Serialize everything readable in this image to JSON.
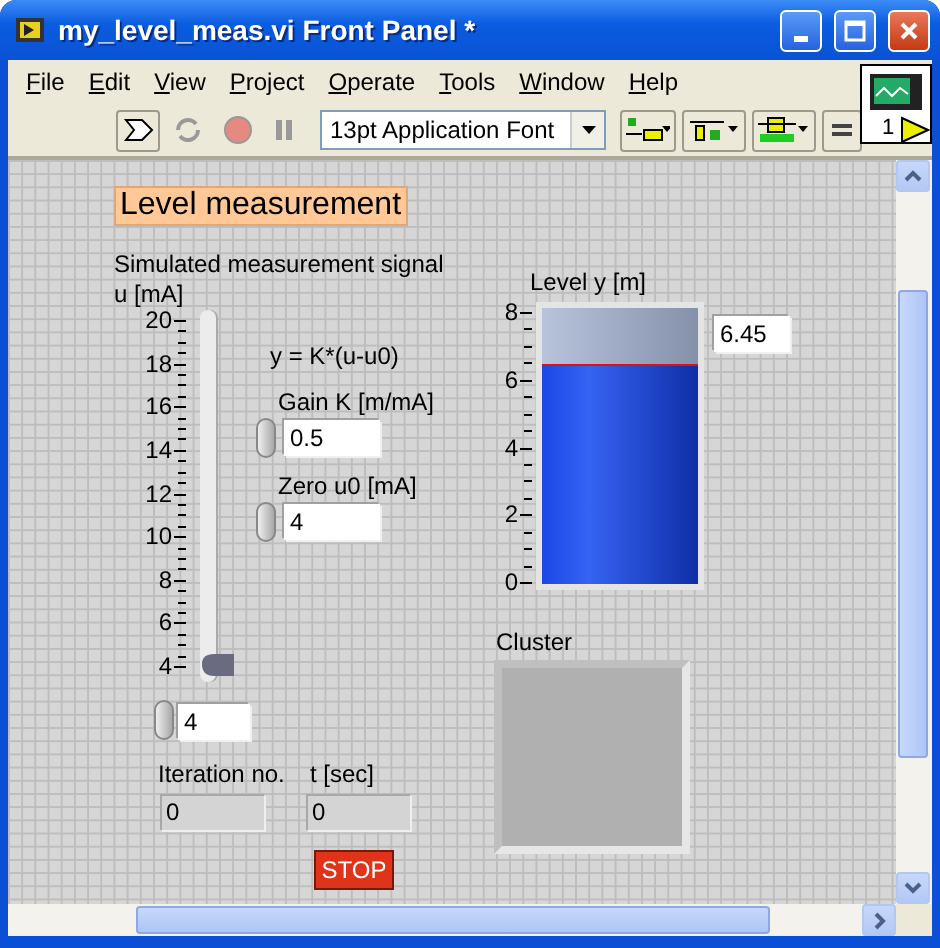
{
  "window": {
    "title": "my_level_meas.vi Front Panel *"
  },
  "menu": [
    "File",
    "Edit",
    "View",
    "Project",
    "Operate",
    "Tools",
    "Window",
    "Help"
  ],
  "toolbar": {
    "font": "13pt Application Font"
  },
  "connector_pane": {
    "text": "1"
  },
  "panel": {
    "heading": "Level measurement",
    "slider": {
      "label": "Simulated measurement signal\nu [mA]",
      "scale": [
        "20",
        "18",
        "16",
        "14",
        "12",
        "10",
        "8",
        "6",
        "4"
      ],
      "level": 0,
      "value": "4"
    },
    "formula": "y = K*(u-u0)",
    "gain": {
      "label": "Gain K [m/mA]",
      "value": "0.5"
    },
    "zero": {
      "label": "Zero u0 [mA]",
      "value": "4"
    },
    "tank": {
      "label": "Level y [m]",
      "scale": [
        "8",
        "6",
        "4",
        "2",
        "0"
      ],
      "level": 0.806,
      "value": "6.45"
    },
    "cluster": {
      "label": "Cluster"
    },
    "iteration": {
      "label": "Iteration no.",
      "value": "0"
    },
    "time": {
      "label": "t [sec]",
      "value": "0"
    },
    "stop": "STOP"
  }
}
